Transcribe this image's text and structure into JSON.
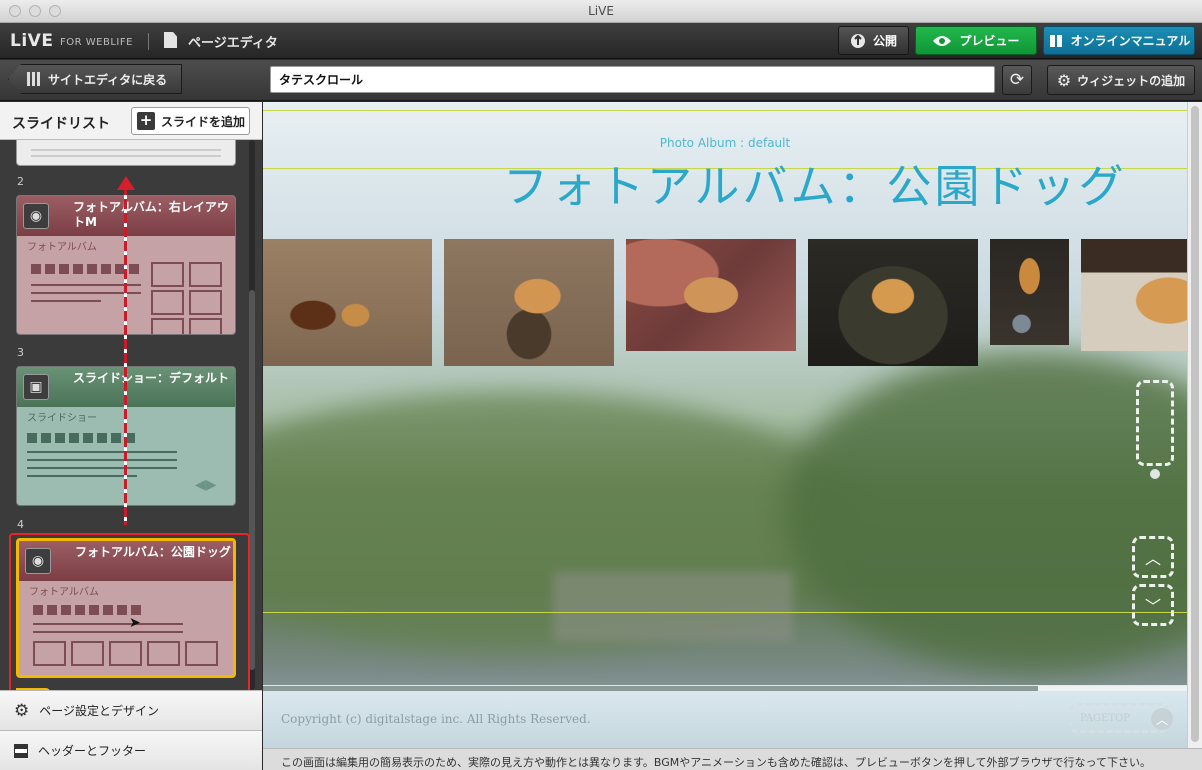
{
  "window": {
    "title": "LiVE"
  },
  "app": {
    "logo": "LiVE",
    "logo_sub": "FOR WEBLIFE",
    "section_title": "ページエディタ",
    "buttons": {
      "publish": "公開",
      "preview": "プレビュー",
      "manual": "オンラインマニュアル"
    }
  },
  "toolbar": {
    "back_label": "サイトエディタに戻る",
    "page_name": "タテスクロール",
    "add_widget": "ウィジェットの追加"
  },
  "sidebar": {
    "title": "スライドリスト",
    "add_slide": "スライドを追加",
    "slides": [
      {
        "num": "2",
        "title": "フォトアルバム：右レイアウトM",
        "type": "フォトアルバム"
      },
      {
        "num": "3",
        "title": "スライドショー：デフォルト",
        "type": "スライドショー"
      },
      {
        "num": "4",
        "title": "フォトアルバム：公園ドッグ",
        "type": "フォトアルバム"
      }
    ],
    "page_settings": "ページ設定とデザイン",
    "header_footer": "ヘッダーとフッター"
  },
  "canvas": {
    "album_label": "Photo Album : default",
    "album_title": "フォトアルバム：公園ドッグ",
    "copyright": "Copyright (c) digitalstage inc. All Rights Reserved.",
    "pagetop": "PAGETOP"
  },
  "notice": "この画面は編集用の簡易表示のため、実際の見え方や動作とは異なります。BGMやアニメーションも含めた確認は、プレビューボタンを押して外部ブラウザで行なって下さい。",
  "colors": {
    "preview": "#109636",
    "manual": "#0d6f96",
    "album_title": "#2aa7c9",
    "selected_border": "#f5b800",
    "delete": "#e63232"
  },
  "icons": [
    "publish-icon",
    "eye-icon",
    "book-icon",
    "refresh-icon",
    "gear-icon",
    "camera-icon",
    "slideshow-icon",
    "pencil-icon",
    "duplicate-icon",
    "minus-icon",
    "header-footer-icon"
  ]
}
